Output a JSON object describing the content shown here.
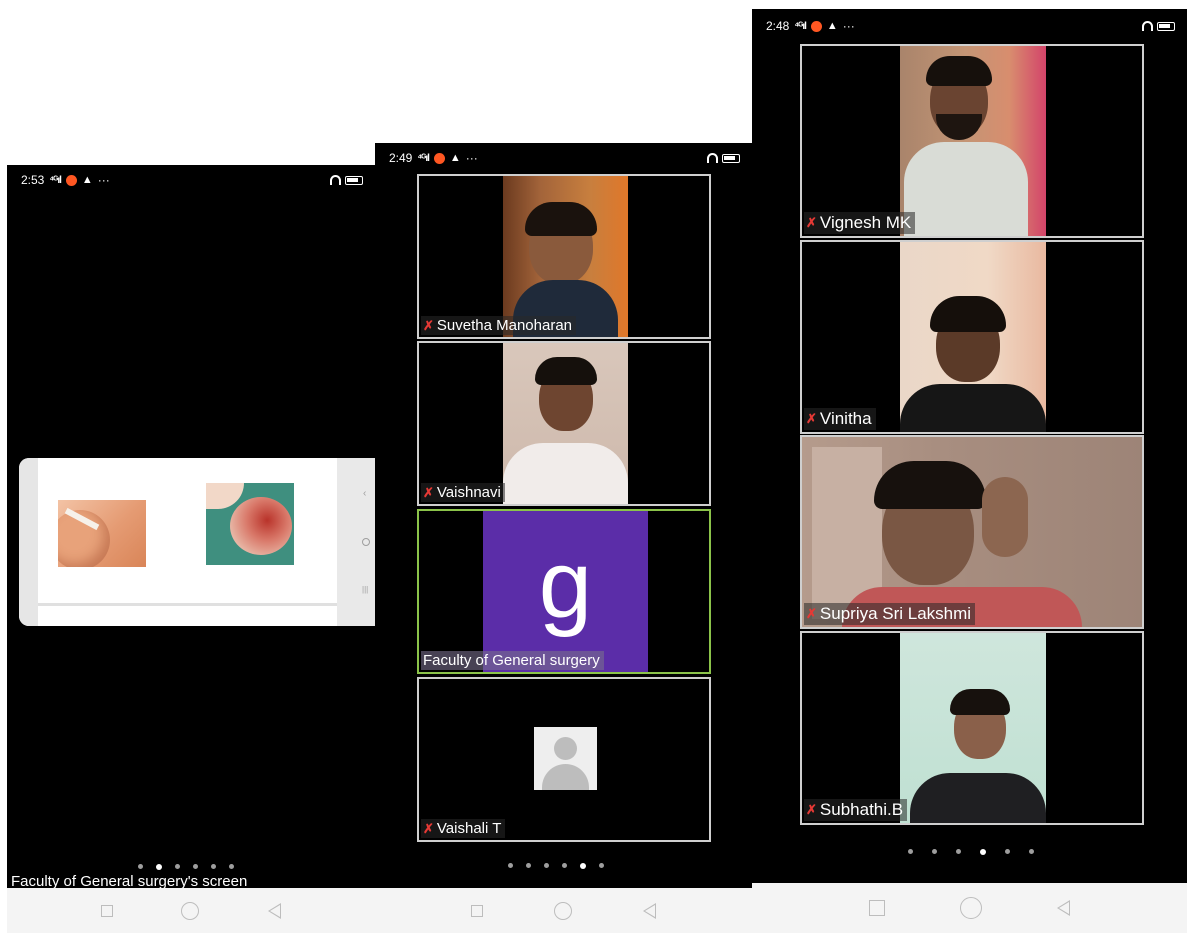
{
  "phone1": {
    "time": "2:53",
    "caption": "Faculty of General surgery's screen",
    "page_dots": 6,
    "active_dot": 1
  },
  "phone2": {
    "time": "2:49",
    "tiles": [
      {
        "name": "Suvetha Manoharan"
      },
      {
        "name": "Vaishnavi"
      },
      {
        "name": "Faculty of General surgery",
        "avatar_letter": "g",
        "avatar_color": "#5b2da8"
      },
      {
        "name": "Vaishali T"
      }
    ],
    "page_dots": 6,
    "active_dot": 4
  },
  "phone3": {
    "time": "2:48",
    "tiles": [
      {
        "name": "Vignesh MK"
      },
      {
        "name": "Vinitha"
      },
      {
        "name": "Supriya Sri Lakshmi"
      },
      {
        "name": "Subhathi.B"
      }
    ],
    "page_dots": 6,
    "active_dot": 3
  },
  "status_icons": [
    "signal-icon",
    "notification-icon",
    "app-icon",
    "more-icon",
    "headphone-icon",
    "battery-icon"
  ],
  "nav_icons": [
    "recent-apps-icon",
    "home-icon",
    "back-icon"
  ],
  "colors": {
    "active_speaker_border": "#8bc34a",
    "mic_muted": "#e53935",
    "accent_notification": "#ff5722"
  }
}
